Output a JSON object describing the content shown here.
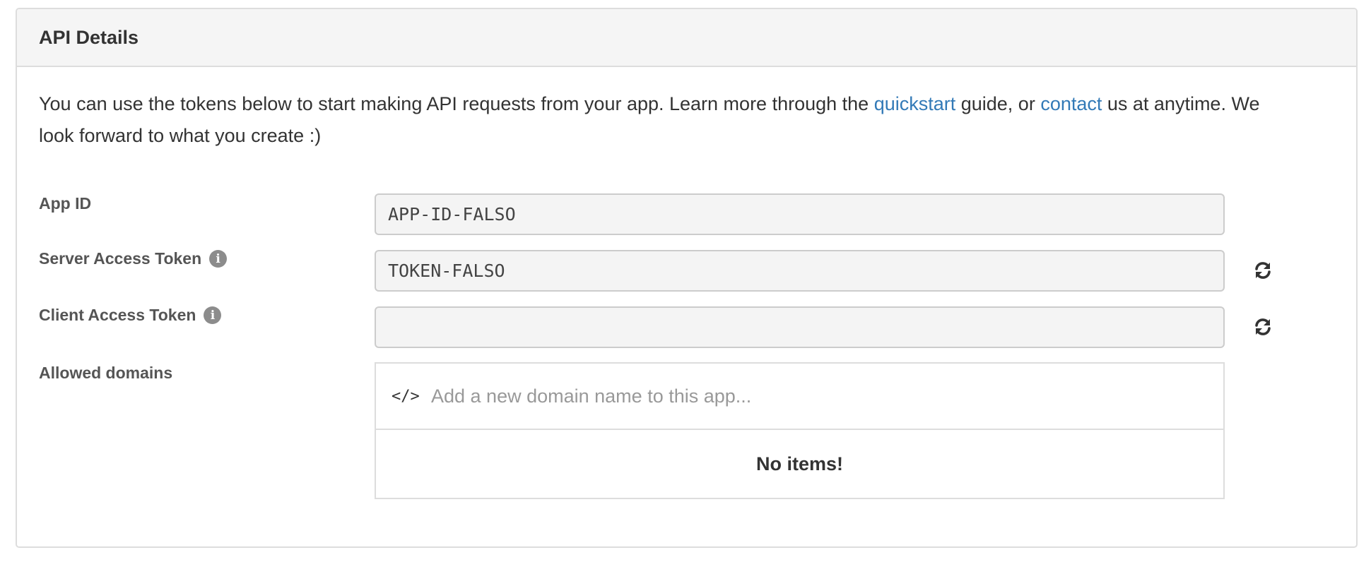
{
  "panel": {
    "title": "API Details"
  },
  "intro": {
    "text_before": "You can use the tokens below to start making API requests from your app. Learn more through the ",
    "quickstart_link": "quickstart",
    "text_middle": " guide, or ",
    "contact_link": "contact",
    "text_after": " us at anytime. We look forward to what you create :)"
  },
  "fields": {
    "app_id": {
      "label": "App ID",
      "value": "APP-ID-FALSO"
    },
    "server_token": {
      "label": "Server Access Token",
      "value": "TOKEN-FALSO",
      "info_icon": "info-circle-icon",
      "refresh_icon": "refresh-icon"
    },
    "client_token": {
      "label": "Client Access Token",
      "value": "",
      "info_icon": "info-circle-icon",
      "refresh_icon": "refresh-icon"
    }
  },
  "domains": {
    "label": "Allowed domains",
    "icon": "code-icon",
    "icon_glyph": "</>",
    "placeholder": "Add a new domain name to this app...",
    "empty_message": "No items!"
  },
  "colors": {
    "link": "#337ab7",
    "heading_bg": "#f5f5f5",
    "field_bg": "#f4f4f4",
    "border": "#dddddd"
  }
}
